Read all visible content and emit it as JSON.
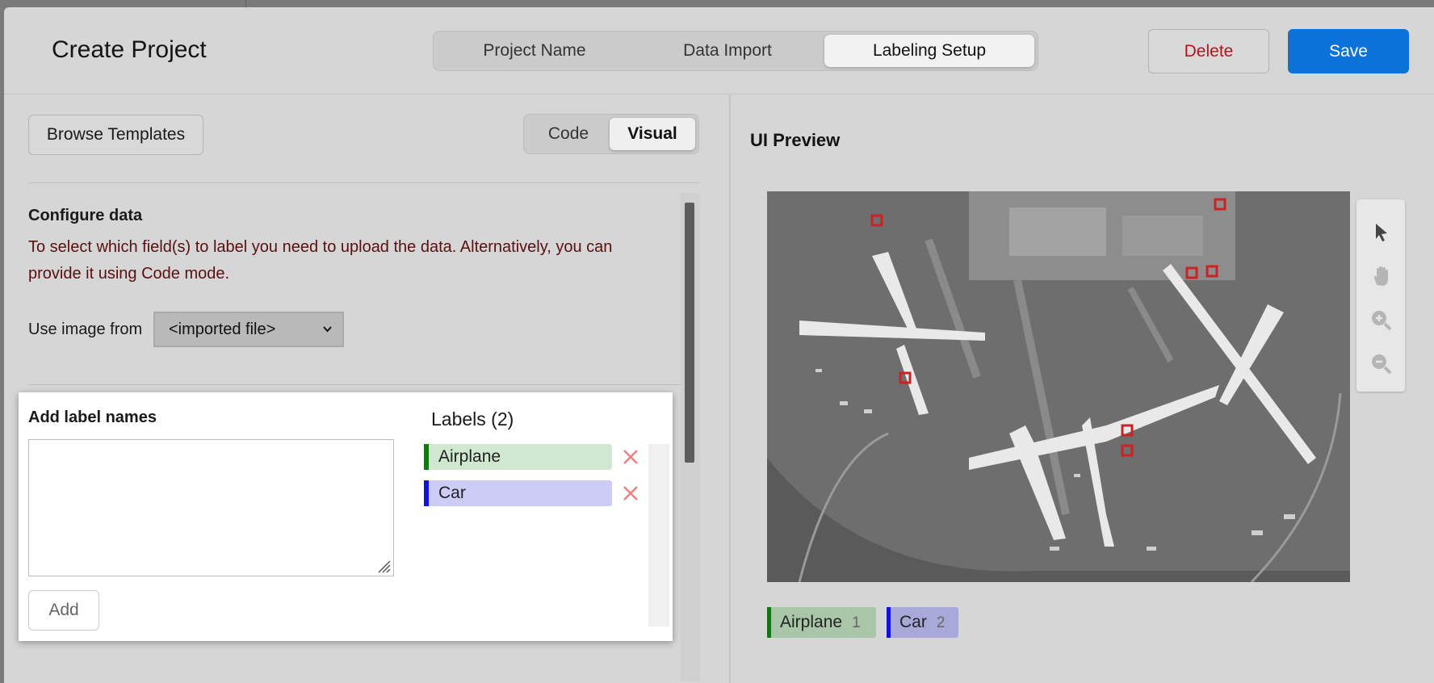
{
  "header": {
    "title": "Create Project",
    "steps": [
      "Project Name",
      "Data Import",
      "Labeling Setup"
    ],
    "active_step": "Labeling Setup",
    "delete_label": "Delete",
    "save_label": "Save"
  },
  "config": {
    "browse_templates_label": "Browse Templates",
    "mode_options": [
      "Code",
      "Visual"
    ],
    "active_mode": "Visual",
    "configure_title": "Configure data",
    "configure_message": "To select which field(s) to label you need to upload the data. Alternatively, you can provide it using Code mode.",
    "use_image_label": "Use image from",
    "use_image_value": "<imported file>",
    "add_label_names_title": "Add label names",
    "textarea_value": "",
    "add_button_label": "Add",
    "labels_title": "Labels (2)",
    "labels": [
      {
        "name": "Airplane",
        "color": "#0e7a0e"
      },
      {
        "name": "Car",
        "color": "#1010e0"
      }
    ]
  },
  "preview": {
    "title": "UI Preview",
    "tools": [
      "pointer-icon",
      "hand-icon",
      "zoom-in-icon",
      "zoom-out-icon"
    ],
    "chips": [
      {
        "name": "Airplane",
        "count": "1",
        "color": "#0e7a0e"
      },
      {
        "name": "Car",
        "count": "2",
        "color": "#1010e0"
      }
    ]
  },
  "colors": {
    "accent": "#0a72d9",
    "danger": "#b5121b",
    "delete_x": "#f08080"
  }
}
